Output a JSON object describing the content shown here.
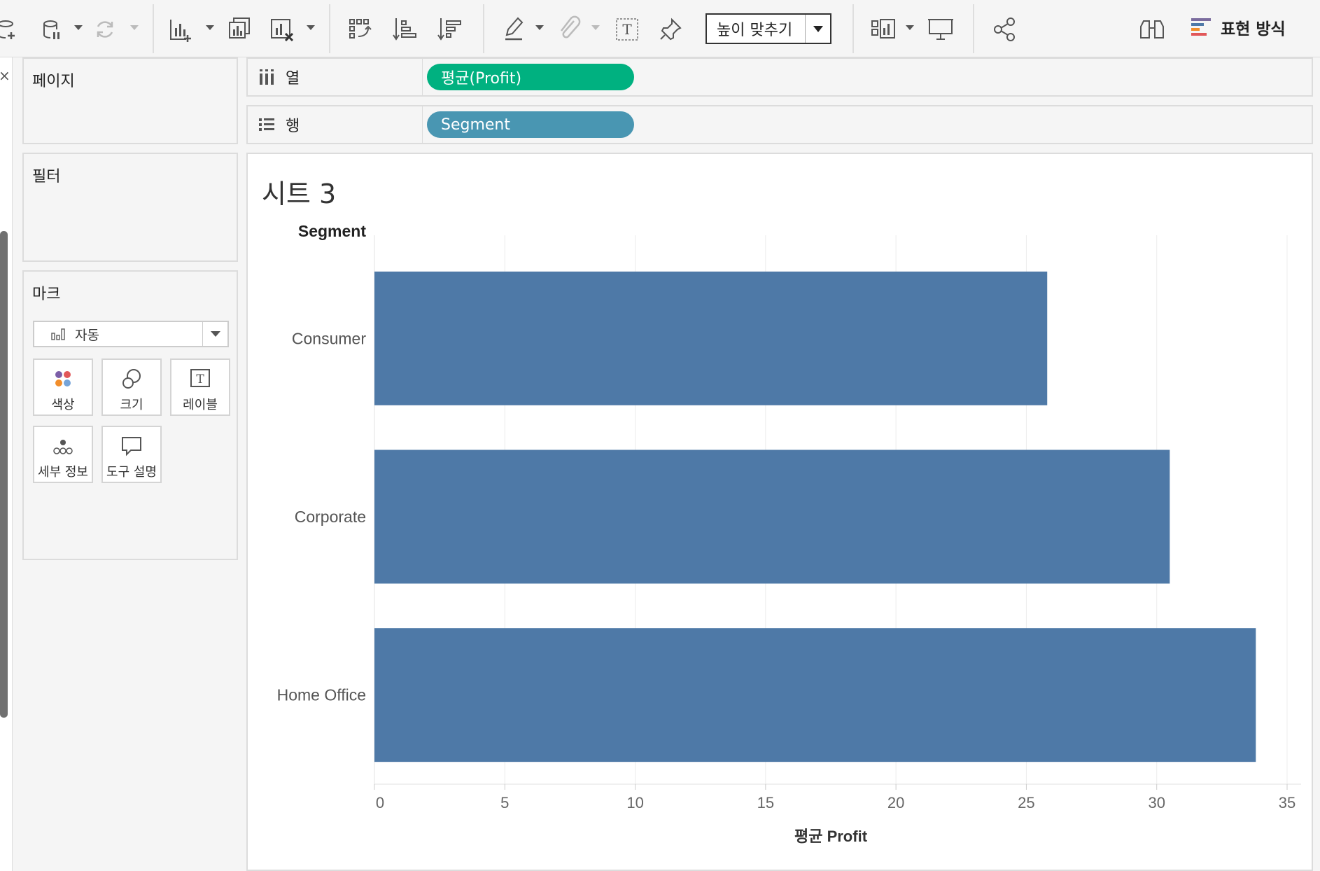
{
  "toolbar": {
    "fit_label": "높이 맞추기",
    "show_me_label": "표현 방식"
  },
  "cards": {
    "pages_title": "페이지",
    "filters_title": "필터",
    "marks_title": "마크",
    "marks_type": "자동",
    "mark_buttons": {
      "color": "색상",
      "size": "크기",
      "label": "레이블",
      "detail": "세부 정보",
      "tooltip": "도구 설명"
    }
  },
  "shelves": {
    "columns_label": "열",
    "columns_pill": "평균(Profit)",
    "rows_label": "행",
    "rows_pill": "Segment"
  },
  "colors": {
    "bar": "#4e79a7",
    "measure_pill": "#00b180",
    "dimension_pill": "#4996b2"
  },
  "sheet": {
    "title": "시트 3"
  },
  "chart_data": {
    "type": "bar",
    "orientation": "horizontal",
    "row_header": "Segment",
    "categories": [
      "Consumer",
      "Corporate",
      "Home Office"
    ],
    "values": [
      25.8,
      30.5,
      33.8
    ],
    "xlabel": "평균 Profit",
    "xlim": [
      0,
      35
    ],
    "xticks": [
      0,
      5,
      10,
      15,
      20,
      25,
      30,
      35
    ],
    "grid": true
  }
}
